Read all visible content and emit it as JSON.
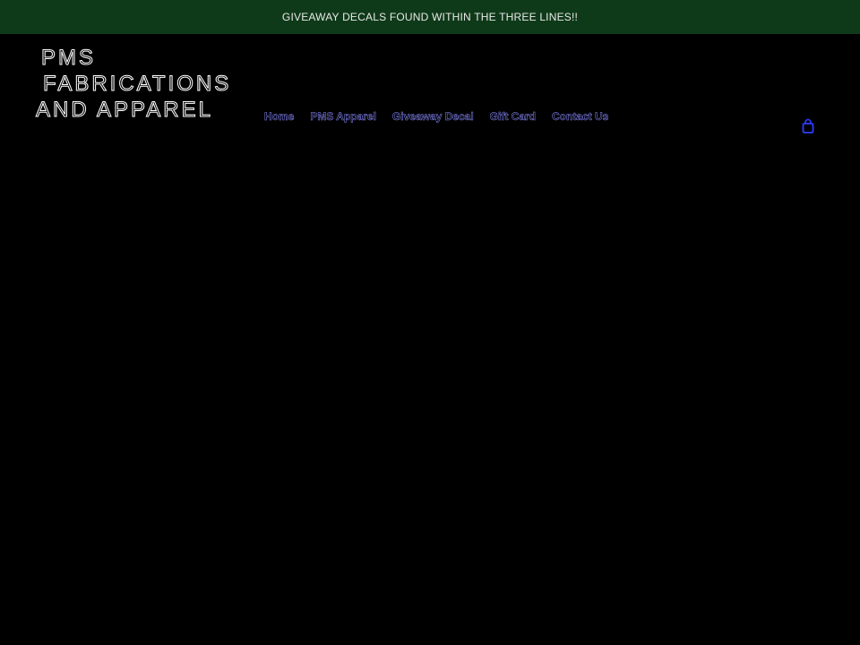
{
  "announcement": {
    "text": "GIVEAWAY DECALS FOUND WITHIN THE THREE LINES!!"
  },
  "logo": {
    "line1": "PMS",
    "line2": "FABRICATIONS",
    "line3": "AND APPAREL"
  },
  "nav": {
    "items": [
      {
        "label": "Home"
      },
      {
        "label": "PMS Apparel"
      },
      {
        "label": "Giveaway Decal"
      },
      {
        "label": "Gift Card"
      },
      {
        "label": "Contact Us"
      }
    ]
  },
  "cart": {
    "icon": "cart-bag-icon",
    "color": "#2f3dff"
  },
  "colors": {
    "background": "#000000",
    "announcement_bg": "#0f3a19",
    "nav_link": "#8a8aff"
  }
}
